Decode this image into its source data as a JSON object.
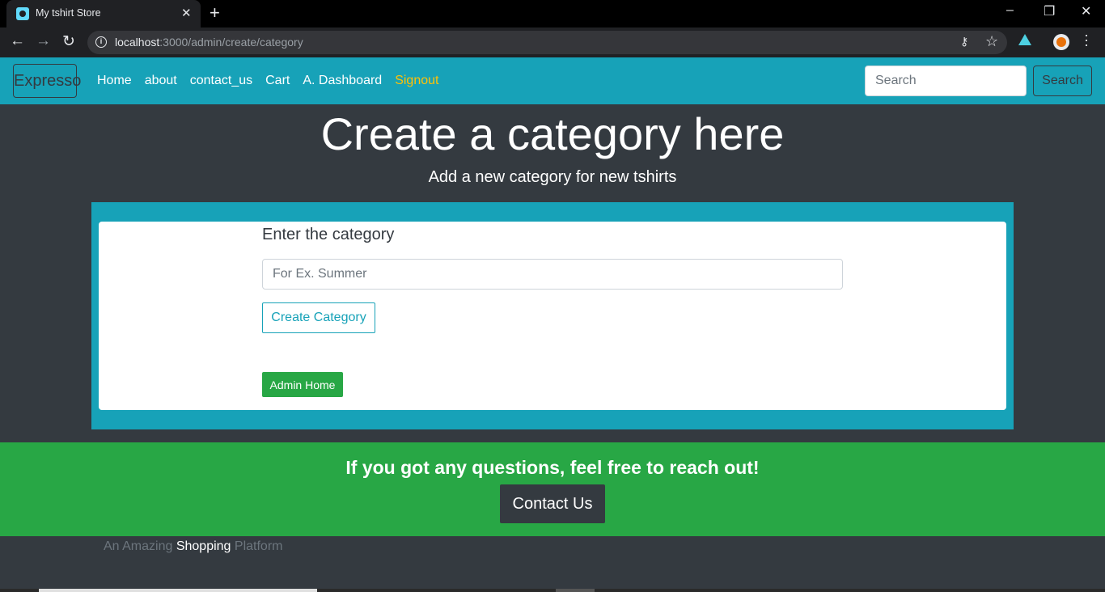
{
  "browser": {
    "tab_title": "My tshirt Store",
    "tab_close": "✕",
    "new_tab": "+",
    "url_host": "localhost",
    "url_path": ":3000/admin/create/category",
    "window_controls": [
      "–",
      "❐",
      "✕"
    ],
    "nav_icons": [
      "back-icon",
      "forward-icon",
      "reload-icon"
    ],
    "nav_glyphs": [
      "←",
      "→",
      "↻"
    ]
  },
  "navbar": {
    "brand": "Expresso",
    "links": [
      "Home",
      "about",
      "contact_us",
      "Cart",
      "A. Dashboard",
      "Signout"
    ],
    "search_placeholder": "Search",
    "search_button": "Search"
  },
  "hero": {
    "title": "Create a category here",
    "subtitle": "Add a new category for new tshirts"
  },
  "form": {
    "label": "Enter the category",
    "input_placeholder": "For Ex. Summer",
    "input_value": "",
    "create_button": "Create Category",
    "admin_home_button": "Admin Home"
  },
  "footer": {
    "text": "If you got any questions, feel free to reach out!",
    "contact_button": "Contact Us",
    "tagline_start": "An Amazing ",
    "tagline_emphasis": "Shopping",
    "tagline_end": " Platform"
  },
  "colors": {
    "info": "#17a2b8",
    "success": "#28a745",
    "dark": "#343a40",
    "warning": "#ffc107"
  }
}
